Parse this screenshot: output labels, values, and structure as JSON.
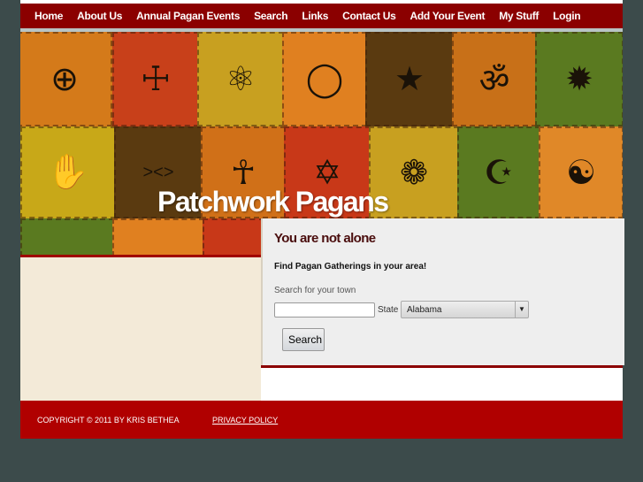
{
  "nav": [
    "Home",
    "About Us",
    "Annual Pagan Events",
    "Search",
    "Links",
    "Contact Us",
    "Add Your Event",
    "My Stuff",
    "Login"
  ],
  "banner": {
    "title": "Patchwork Pagans",
    "tiles": [
      {
        "color": "#d47a1a",
        "symbol": "⊕",
        "icon": "sun-cross-icon"
      },
      {
        "color": "#c8401a",
        "symbol": "☩",
        "icon": "leviathan-cross-icon"
      },
      {
        "color": "#c8a020",
        "symbol": "⚛",
        "icon": "atom-icon"
      },
      {
        "color": "#e08020",
        "symbol": "◯",
        "icon": "ouroboros-icon"
      },
      {
        "color": "#5a3a10",
        "symbol": "★",
        "icon": "pentagram-icon"
      },
      {
        "color": "#c87018",
        "symbol": "ॐ",
        "icon": "om-icon"
      },
      {
        "color": "#5a7a20",
        "symbol": "✹",
        "icon": "nine-point-star-icon"
      },
      {
        "color": "#c8a818",
        "symbol": "✋",
        "icon": "hamsa-icon"
      },
      {
        "color": "#5a3a10",
        "symbol": "><>",
        "icon": "ichthys-icon"
      },
      {
        "color": "#d07018",
        "symbol": "☥",
        "icon": "human-figure-icon"
      },
      {
        "color": "#c83818",
        "symbol": "✡",
        "icon": "star-of-david-icon"
      },
      {
        "color": "#c8a020",
        "symbol": "❁",
        "icon": "flower-icon"
      },
      {
        "color": "#5a7a20",
        "symbol": "☪",
        "icon": "star-crescent-icon"
      },
      {
        "color": "#e08828",
        "symbol": "☯",
        "icon": "yin-yang-icon"
      },
      {
        "color": "#5a7a20",
        "symbol": "",
        "icon": ""
      },
      {
        "color": "#e08020",
        "symbol": "",
        "icon": ""
      },
      {
        "color": "#c83818",
        "symbol": "",
        "icon": ""
      }
    ]
  },
  "panel": {
    "heading": "You are not alone",
    "subheading": "Find Pagan Gatherings in your area!",
    "town_label": "Search for your town",
    "town_value": "",
    "state_label": "State",
    "state_value": "Alabama",
    "search_button": "Search"
  },
  "footer": {
    "copyright": "COPYRIGHT © 2011 BY KRIS BETHEA",
    "privacy": "PRIVACY POLICY"
  }
}
